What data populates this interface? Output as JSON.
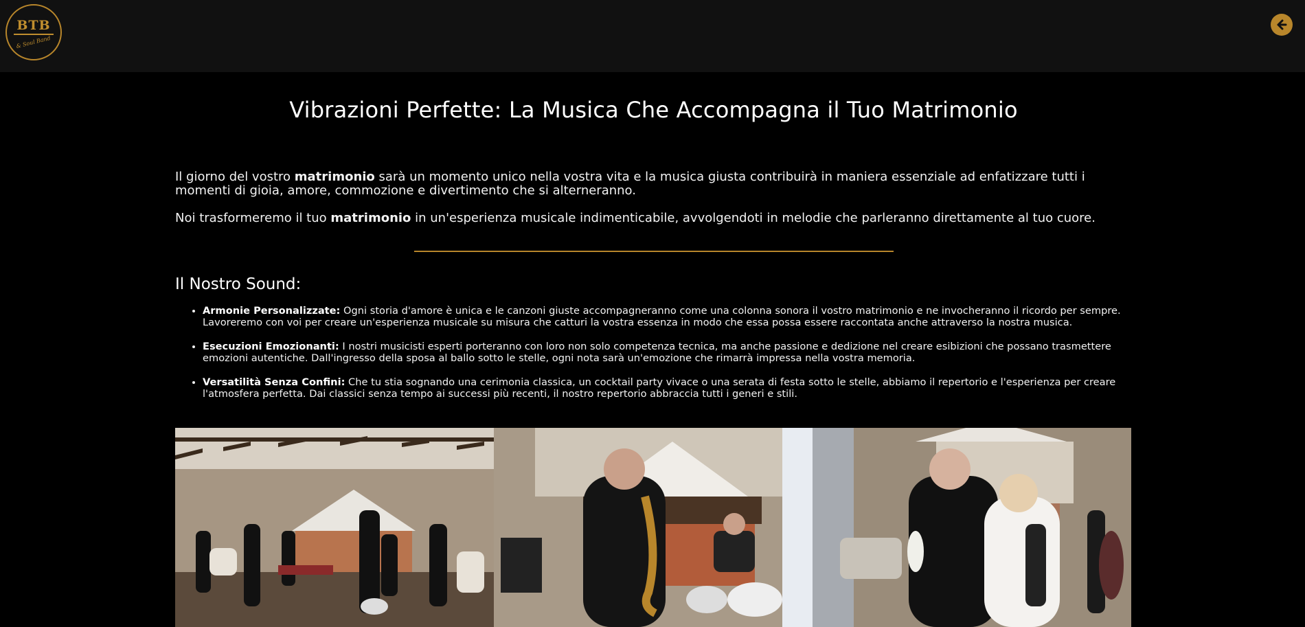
{
  "header": {
    "logo_text": "BTB",
    "logo_subtext": "& Soul Band",
    "back_icon": "arrow-left-circle-icon",
    "accent": "#b8862b"
  },
  "main": {
    "title": "Vibrazioni Perfette: La Musica Che Accompagna il Tuo Matrimonio",
    "intro": {
      "p1_before": "Il giorno del vostro ",
      "p1_bold": "matrimonio",
      "p1_after": " sarà un momento unico nella vostra vita e la musica giusta contribuirà in maniera essenziale ad enfatizzare tutti i momenti di gioia, amore, commozione e divertimento che si alterneranno.",
      "p2_before": "Noi trasformeremo il tuo ",
      "p2_bold": "matrimonio",
      "p2_after": " in un'esperienza musicale indimenticabile, avvolgendoti in melodie che parleranno direttamente al tuo cuore."
    },
    "section_title": "Il Nostro Sound:",
    "features": [
      {
        "title": "Armonie Personalizzate:",
        "text": " Ogni storia d'amore è unica e le canzoni giuste accompagneranno come una colonna sonora il vostro matrimonio e ne invocheranno il ricordo per sempre. Lavoreremo con voi per creare un'esperienza musicale su misura che catturi la vostra essenza in modo che essa possa essere raccontata anche attraverso la nostra musica."
      },
      {
        "title": "Esecuzioni Emozionanti:",
        "text": " I nostri musicisti esperti porteranno con loro non solo competenza tecnica, ma anche passione e dedizione nel creare esibizioni che possano trasmettere emozioni autentiche. Dall'ingresso della sposa al ballo sotto le stelle, ogni nota sarà un'emozione che rimarrà impressa nella vostra memoria."
      },
      {
        "title": "Versatilità Senza Confini:",
        "text": " Che tu stia sognando una cerimonia classica, un cocktail party vivace o una serata di festa sotto le stelle, abbiamo il repertorio e l'esperienza per creare l'atmosfera perfetta. Dai classici senza tempo ai successi più recenti, il nostro repertorio abbraccia tutti i generi e stili."
      }
    ],
    "gallery": [
      {
        "alt": "band-performing-photo"
      },
      {
        "alt": "saxophonist-photo"
      },
      {
        "alt": "couple-dancing-photo"
      }
    ]
  }
}
